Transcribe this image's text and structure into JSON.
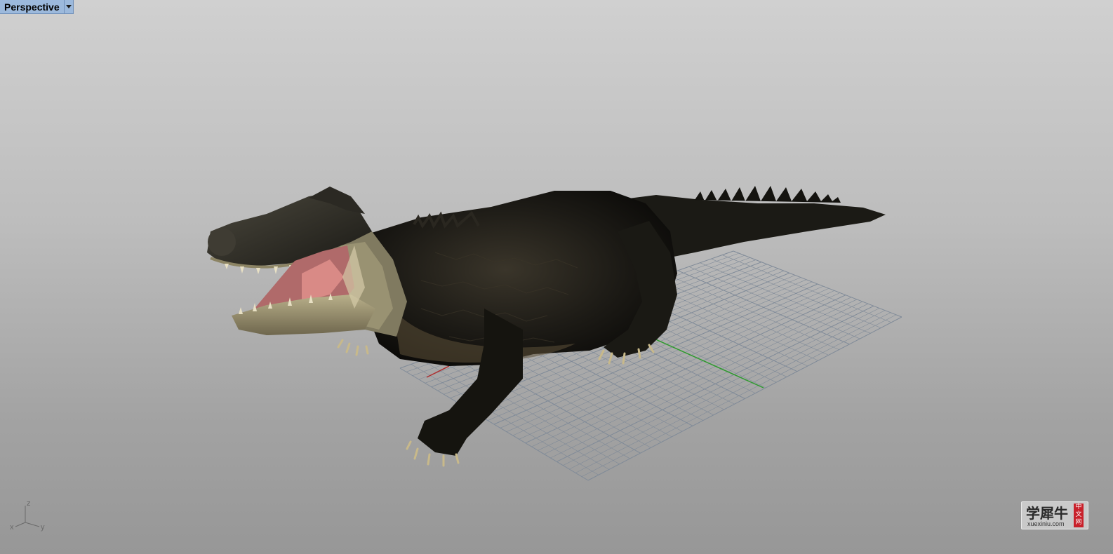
{
  "viewport": {
    "title": "Perspective",
    "menu_icon": "chevron-down-icon",
    "axes": {
      "z": "z",
      "x": "x",
      "y": "y"
    }
  },
  "watermark": {
    "main": "学犀牛",
    "sub": "xuexiniu.com",
    "badge_chars": [
      "中",
      "文",
      "网"
    ]
  },
  "colors": {
    "label_bg": "#9cb9dc",
    "grid": "#7f8a98",
    "axis_x": "#b03030",
    "axis_y": "#2e9a2e",
    "model_body": "#1c1a15"
  }
}
